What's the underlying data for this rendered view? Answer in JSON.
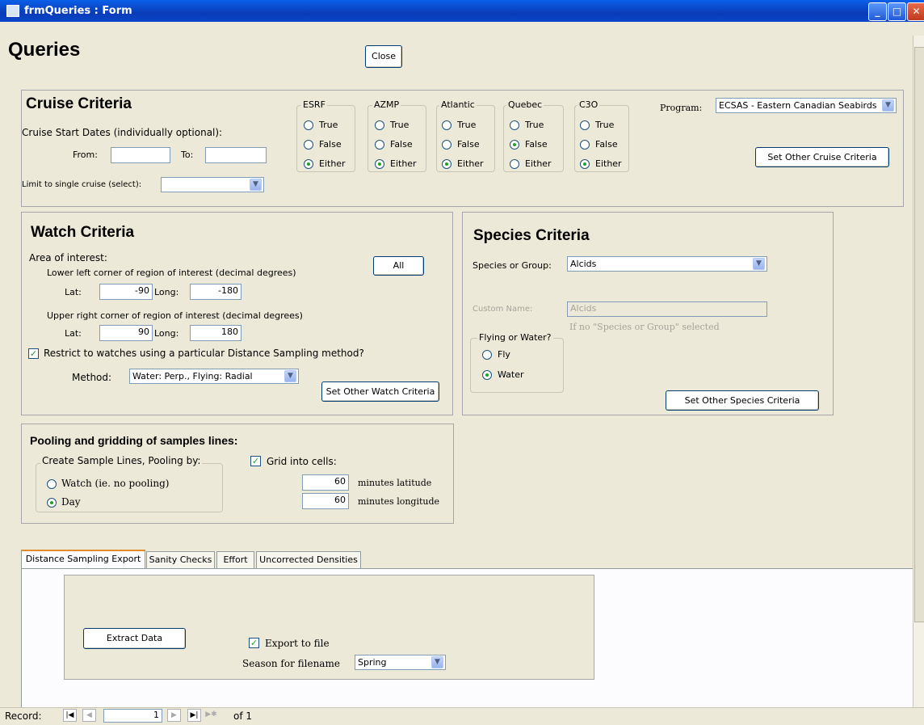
{
  "window": {
    "title": "frmQueries : Form"
  },
  "form": {
    "title": "Queries",
    "close_label": "Close"
  },
  "cruise": {
    "heading": "Cruise Criteria",
    "dates_label": "Cruise Start Dates (individually optional):",
    "from_label": "From:",
    "to_label": "To:",
    "from_value": "",
    "to_value": "",
    "single_label": "Limit to single cruise (select):",
    "single_value": "",
    "groups": [
      {
        "label": "ESRF",
        "selected": "Either"
      },
      {
        "label": "AZMP",
        "selected": "Either"
      },
      {
        "label": "Atlantic",
        "selected": "Either"
      },
      {
        "label": "Quebec",
        "selected": "False"
      },
      {
        "label": "C3O",
        "selected": "Either"
      }
    ],
    "options": [
      "True",
      "False",
      "Either"
    ],
    "program_label": "Program:",
    "program_value": "ECSAS - Eastern Canadian Seabirds",
    "set_other_label": "Set Other Cruise Criteria"
  },
  "watch": {
    "heading": "Watch Criteria",
    "area_label": "Area of interest:",
    "lower_label": "Lower left corner of region of interest  (decimal degrees)",
    "upper_label": "Upper right corner of region of interest (decimal degrees)",
    "lat_label": "Lat:",
    "long_label": "Long:",
    "lower_lat": "-90",
    "lower_long": "-180",
    "upper_lat": "90",
    "upper_long": "180",
    "all_label": "All",
    "restrict_label": "Restrict to watches using a particular Distance Sampling method?",
    "restrict_checked": true,
    "method_label": "Method:",
    "method_value": "Water: Perp., Flying: Radial",
    "set_other_label": "Set Other Watch Criteria"
  },
  "species": {
    "heading": "Species Criteria",
    "group_label": "Species or Group:",
    "group_value": "Alcids",
    "custom_label": "Custom Name:",
    "custom_value": "Alcids",
    "custom_note": "If no \"Species or Group\" selected",
    "flying_label": "Flying or Water?",
    "fly_label": "Fly",
    "water_label": "Water",
    "selected": "Water",
    "set_other_label": "Set Other Species Criteria"
  },
  "pooling": {
    "heading": "Pooling and gridding of samples lines:",
    "create_label": "Create Sample Lines, Pooling by:",
    "watch_option": "Watch (ie. no pooling)",
    "day_option": "Day",
    "selected": "Day",
    "grid_label": "Grid into cells:",
    "grid_checked": true,
    "lat_minutes": "60",
    "long_minutes": "60",
    "lat_unit": "minutes latitude",
    "long_unit": "minutes longitude"
  },
  "tabs": [
    {
      "label": "Distance Sampling Export",
      "active": true
    },
    {
      "label": "Sanity Checks",
      "active": false
    },
    {
      "label": "Effort",
      "active": false
    },
    {
      "label": "Uncorrected Densities",
      "active": false
    }
  ],
  "export": {
    "extract_label": "Extract Data",
    "export_label": "Export to file",
    "export_checked": true,
    "season_label": "Season for filename",
    "season_value": "Spring"
  },
  "record_nav": {
    "label": "Record:",
    "current": "1",
    "of_label": "of 1"
  }
}
